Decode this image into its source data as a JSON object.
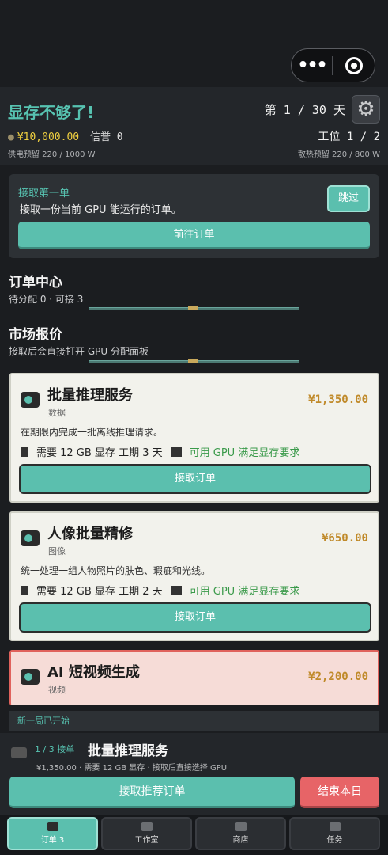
{
  "header": {
    "title": "显存不够了!",
    "day": "第 1 / 30 天",
    "money": "¥10,000.00",
    "reputation": "信誉 0",
    "workstation": "工位 1 / 2",
    "power": "供电预留 220 / 1000 W",
    "cooling": "散热预留 220 / 800 W"
  },
  "guide": {
    "title": "接取第一单",
    "desc": "接取一份当前 GPU 能运行的订单。",
    "skip": "跳过",
    "goto": "前往订单"
  },
  "order_center": {
    "title": "订单中心",
    "status": "待分配 0 · 可接 3"
  },
  "market": {
    "title": "市场报价",
    "subtitle": "接取后会直接打开 GPU 分配面板"
  },
  "orders": [
    {
      "name": "批量推理服务",
      "category": "数据",
      "price": "¥1,350.00",
      "desc": "在期限内完成一批离线推理请求。",
      "need": "需要 12 GB 显存",
      "period": "工期 3 天",
      "fit": "可用 GPU 满足显存要求",
      "action": "接取订单"
    },
    {
      "name": "人像批量精修",
      "category": "图像",
      "price": "¥650.00",
      "desc": "统一处理一组人物照片的肤色、瑕疵和光线。",
      "need": "需要 12 GB 显存",
      "period": "工期 2 天",
      "fit": "可用 GPU 满足显存要求",
      "action": "接取订单"
    },
    {
      "name": "AI 短视频生成",
      "category": "视频",
      "price": "¥2,200.00"
    }
  ],
  "toast": "新一局已开始",
  "recommend": {
    "index": "1 / 3 接单",
    "name": "批量推理服务",
    "info": "¥1,350.00 · 需要 12 GB 显存 · 接取后直接选择 GPU",
    "accept": "接取推荐订单",
    "end_day": "结束本日"
  },
  "tabs": [
    "订单 3",
    "工作室",
    "商店",
    "任务"
  ],
  "colors": {
    "accent": "#5bbfae",
    "danger": "#e76467",
    "price": "#c08a2a",
    "ok": "#3a9a4a"
  }
}
